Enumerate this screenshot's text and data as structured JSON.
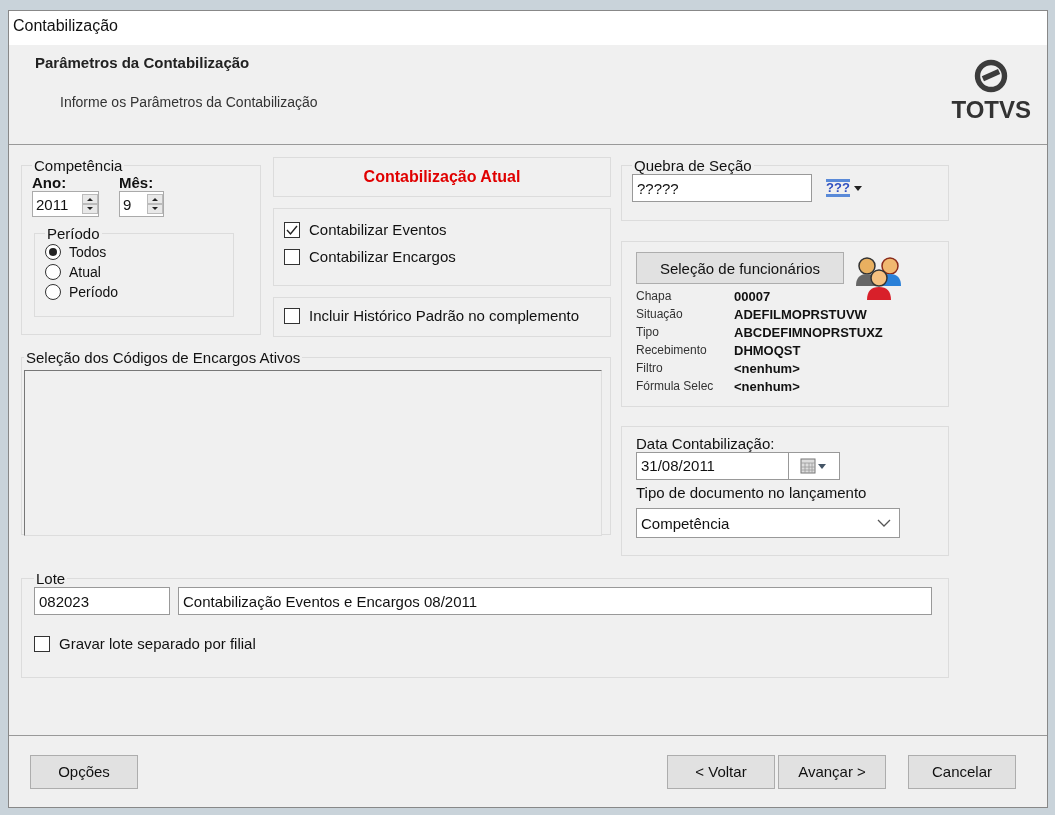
{
  "window": {
    "title": "Contabilização"
  },
  "header": {
    "title": "Parâmetros da Contabilização",
    "subtitle": "Informe os Parâmetros da Contabilização",
    "logo_text": "TOTVS"
  },
  "competencia": {
    "legend": "Competência",
    "year_label": "Ano:",
    "year": "2011",
    "month_label": "Mês:",
    "month": "9",
    "periodo": {
      "legend": "Período",
      "options": [
        {
          "label": "Todos",
          "selected": true
        },
        {
          "label": "Atual",
          "selected": false
        },
        {
          "label": "Período",
          "selected": false
        }
      ]
    }
  },
  "current_banner": "Contabilização Atual",
  "options": [
    {
      "label": "Contabilizar Eventos",
      "checked": true
    },
    {
      "label": "Contabilizar Encargos",
      "checked": false
    }
  ],
  "historico": {
    "label": "Incluir Histórico Padrão no complemento",
    "checked": false
  },
  "encargos": {
    "legend": "Seleção dos Códigos de Encargos Ativos"
  },
  "quebra_secao": {
    "legend": "Quebra de Seção",
    "value": "?????",
    "picker_label": "???"
  },
  "selecao_funcionarios": {
    "button": "Seleção de funcionários",
    "fields": [
      {
        "label": "Chapa",
        "value": "00007"
      },
      {
        "label": "Situação",
        "value": "ADEFILMOPRSTUVW"
      },
      {
        "label": "Tipo",
        "value": "ABCDEFIMNOPRSTUXZ"
      },
      {
        "label": "Recebimento",
        "value": "DHMOQST"
      },
      {
        "label": "Filtro",
        "value": "<nenhum>"
      },
      {
        "label": "Fórmula Selec",
        "value": "<nenhum>"
      }
    ]
  },
  "data": {
    "label": "Data Contabilização:",
    "value": "31/08/2011",
    "doc_type_label": "Tipo de documento no lançamento",
    "doc_type": "Competência"
  },
  "lote": {
    "legend": "Lote",
    "number": "082023",
    "description": "Contabilização Eventos e Encargos 08/2011",
    "separate": {
      "label": "Gravar lote separado por filial",
      "checked": false
    }
  },
  "footer": {
    "left_button": "Opções",
    "buttons": [
      "< Voltar",
      "Avançar >",
      "Cancelar"
    ]
  }
}
